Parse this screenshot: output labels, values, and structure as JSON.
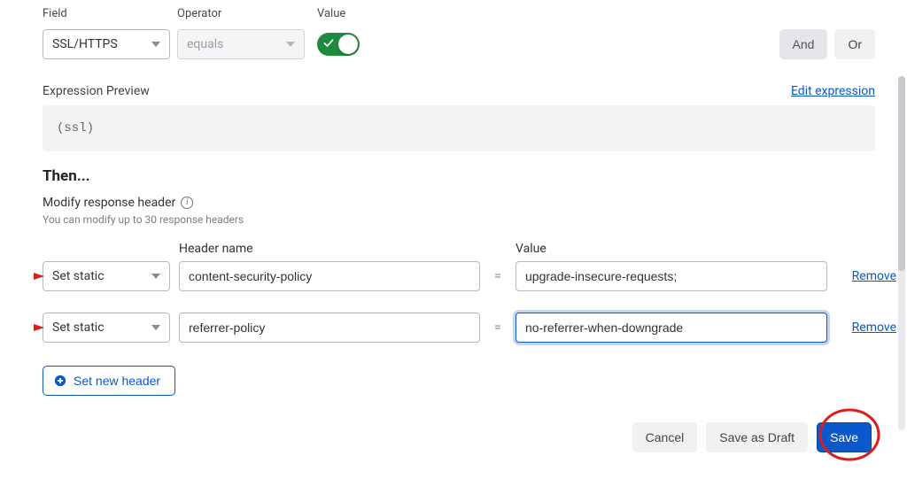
{
  "condition": {
    "field_label": "Field",
    "operator_label": "Operator",
    "value_label": "Value",
    "field_value": "SSL/HTTPS",
    "operator_value": "equals",
    "toggle_on": true,
    "and_label": "And",
    "or_label": "Or"
  },
  "preview": {
    "label": "Expression Preview",
    "edit_link": "Edit expression",
    "expression": "(ssl)"
  },
  "then": {
    "title": "Then...",
    "subtitle": "Modify response header",
    "caption": "You can modify up to 30 response headers",
    "header_name_label": "Header name",
    "value_label": "Value",
    "rows": [
      {
        "mode": "Set static",
        "name": "content-security-policy",
        "value": "upgrade-insecure-requests;",
        "focused": false
      },
      {
        "mode": "Set static",
        "name": "referrer-policy",
        "value": "no-referrer-when-downgrade",
        "focused": true
      }
    ],
    "remove_label": "Remove",
    "add_button": "Set new header"
  },
  "footer": {
    "cancel": "Cancel",
    "draft": "Save as Draft",
    "save": "Save"
  }
}
